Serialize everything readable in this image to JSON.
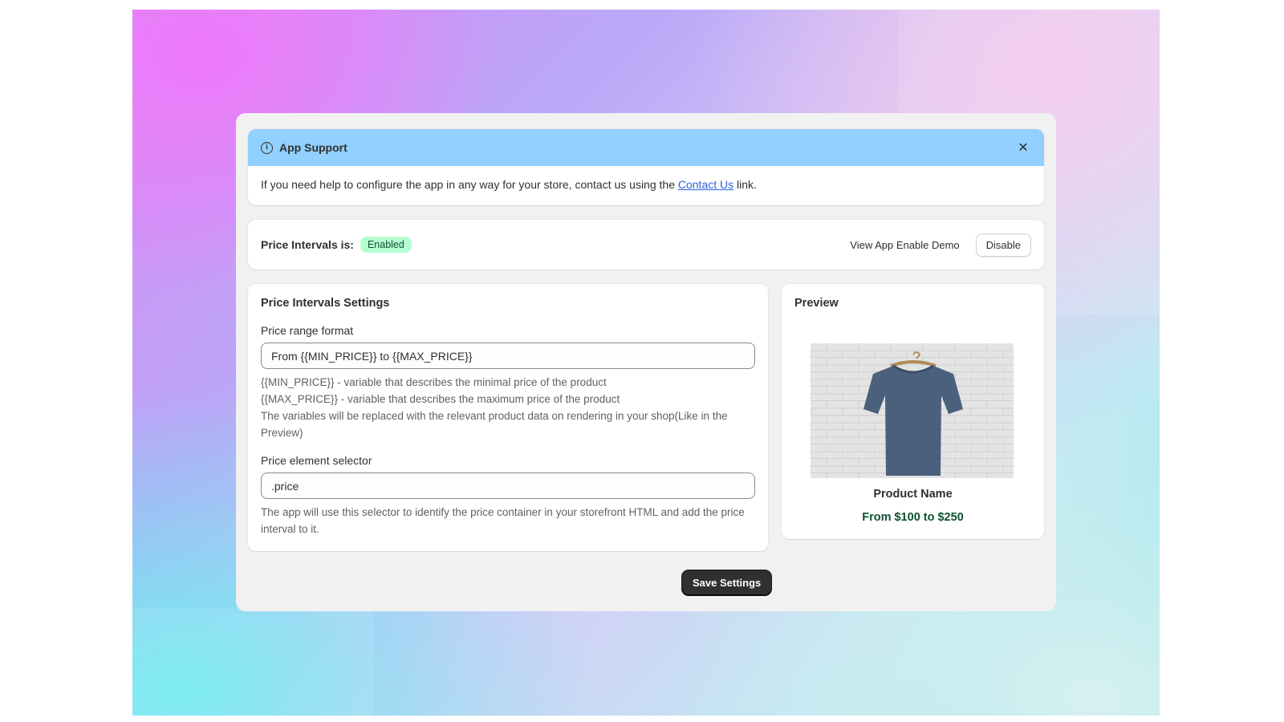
{
  "support": {
    "title": "App Support",
    "body_before": "If you need help to configure the app in any way for your store, contact us using the ",
    "link_text": "Contact Us",
    "body_after": " link."
  },
  "status": {
    "label": "Price Intervals is:",
    "badge": "Enabled",
    "demo_link": "View App Enable Demo",
    "disable_button": "Disable"
  },
  "settings": {
    "title": "Price Intervals Settings",
    "format_label": "Price range format",
    "format_value": "From {{MIN_PRICE}} to {{MAX_PRICE}}",
    "format_help": [
      "{{MIN_PRICE}} - variable that describes the minimal price of the product",
      "{{MAX_PRICE}} - variable that describes the maximum price of the product",
      "The variables will be replaced with the relevant product data on rendering in your shop(Like in the Preview)"
    ],
    "selector_label": "Price element selector",
    "selector_value": ".price",
    "selector_help": "The app will use this selector to identify the price container in your storefront HTML and add the price interval to it."
  },
  "preview": {
    "title": "Preview",
    "product_name": "Product Name",
    "product_price": "From $100 to $250"
  },
  "actions": {
    "save_button": "Save Settings"
  },
  "icons": {
    "info": "info-icon",
    "close": "close-icon"
  },
  "colors": {
    "banner": "#91d0ff",
    "badge_bg": "#b4fed2",
    "badge_text": "#0c5132",
    "price_text": "#0c5132",
    "primary_button": "#303030",
    "link": "#2c5fd9"
  }
}
